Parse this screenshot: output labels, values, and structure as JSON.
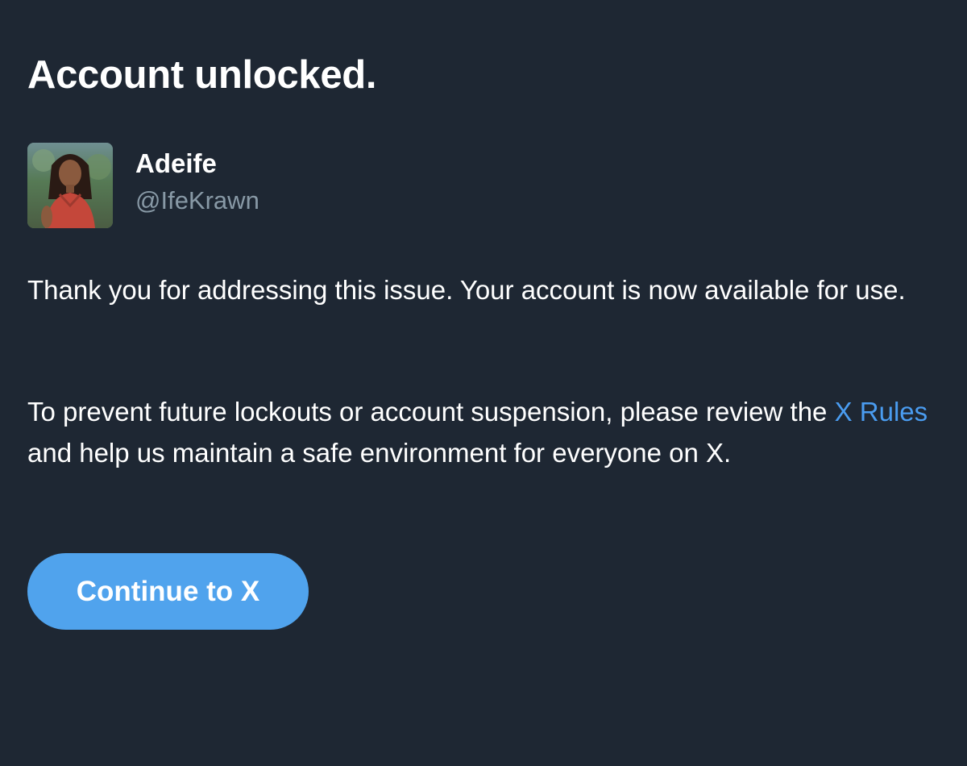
{
  "title": "Account unlocked.",
  "account": {
    "display_name": "Adeife",
    "handle": "@IfeKrawn",
    "avatar_icon": "user-avatar-photo"
  },
  "message": {
    "paragraph1": "Thank you for addressing this issue. Your account is now available for use.",
    "paragraph2_before": "To prevent future lockouts or account suspension, please review the ",
    "paragraph2_link": "X Rules",
    "paragraph2_after": " and help us maintain a safe environment for everyone on X."
  },
  "continue_button": {
    "label": "Continue to X"
  },
  "colors": {
    "background": "#1e2733",
    "text": "#ffffff",
    "secondary_text": "#8899a6",
    "link": "#4a9cf0",
    "button": "#50a3ed"
  }
}
